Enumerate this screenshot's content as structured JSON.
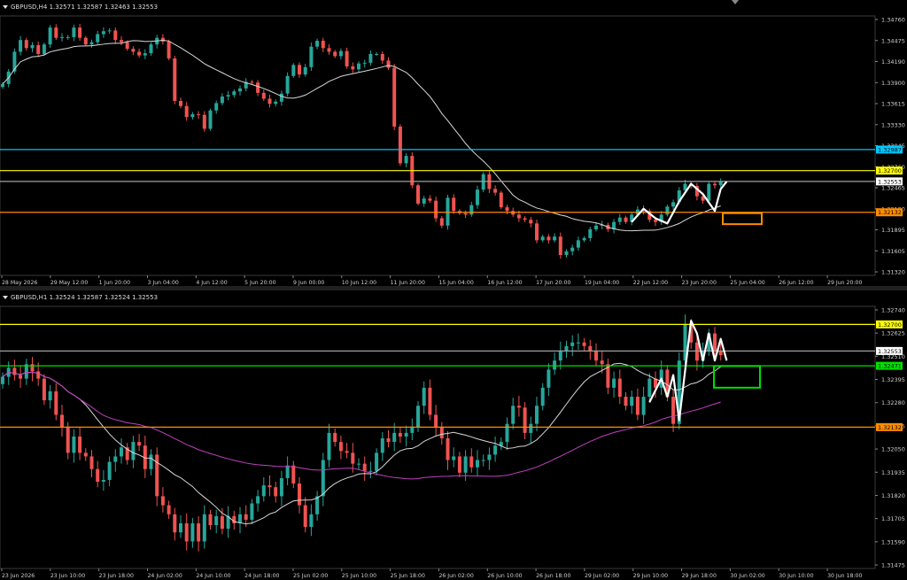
{
  "chart_data": [
    {
      "type": "candlestick",
      "symbol_label": "GBPUSD,H4  1.32571 1.32587 1.32463 1.32553",
      "ylim": [
        1.3132,
        1.3476
      ],
      "y_ticks": [
        "1.34760",
        "1.34475",
        "1.34190",
        "1.33900",
        "1.33615",
        "1.33330",
        "1.33045",
        "1.32760",
        "1.32465",
        "1.32180",
        "1.31895",
        "1.31605",
        "1.31320"
      ],
      "x_ticks": [
        "28 May 2026",
        "29 May 12:00",
        "1 Jun 20:00",
        "3 Jun 04:00",
        "4 Jun 12:00",
        "5 Jun 20:00",
        "9 Jun 00:00",
        "10 Jun 12:00",
        "11 Jun 20:00",
        "15 Jun 04:00",
        "16 Jun 12:00",
        "17 Jun 20:00",
        "19 Jun 04:00",
        "22 Jun 12:00",
        "23 Jun 20:00",
        "25 Jun 04:00",
        "26 Jun 12:00",
        "29 Jun 20:00"
      ],
      "closes": [
        1.3388,
        1.3405,
        1.3432,
        1.3448,
        1.3437,
        1.3441,
        1.3429,
        1.3442,
        1.3465,
        1.3451,
        1.3452,
        1.3452,
        1.3465,
        1.3451,
        1.3442,
        1.3445,
        1.3456,
        1.346,
        1.3461,
        1.3448,
        1.3445,
        1.3436,
        1.3432,
        1.3427,
        1.343,
        1.3442,
        1.3451,
        1.3446,
        1.3423,
        1.3365,
        1.3358,
        1.3343,
        1.3347,
        1.3346,
        1.3327,
        1.3352,
        1.3362,
        1.3371,
        1.3373,
        1.3378,
        1.3382,
        1.3391,
        1.339,
        1.3376,
        1.3368,
        1.3361,
        1.3364,
        1.3375,
        1.3399,
        1.3414,
        1.3401,
        1.3411,
        1.3439,
        1.3447,
        1.3437,
        1.3432,
        1.3426,
        1.3433,
        1.3412,
        1.3408,
        1.3416,
        1.3417,
        1.3429,
        1.3429,
        1.342,
        1.341,
        1.333,
        1.328,
        1.329,
        1.325,
        1.3225,
        1.3232,
        1.3229,
        1.3205,
        1.3195,
        1.3233,
        1.3215,
        1.3212,
        1.321,
        1.3223,
        1.3244,
        1.3265,
        1.3245,
        1.324,
        1.322,
        1.3215,
        1.321,
        1.3205,
        1.3203,
        1.3198,
        1.3175,
        1.318,
        1.3175,
        1.318,
        1.3155,
        1.316,
        1.3165,
        1.3175,
        1.3178,
        1.319,
        1.3195,
        1.3196,
        1.319,
        1.32,
        1.3206,
        1.32,
        1.321,
        1.3217,
        1.3215,
        1.3203,
        1.32,
        1.321,
        1.3221,
        1.3227,
        1.3243,
        1.3252,
        1.3249,
        1.3235,
        1.3229,
        1.3252,
        1.325,
        1.3255
      ],
      "lines": [
        {
          "name": "1.32987",
          "value": 1.32987,
          "color": "#00c8ff"
        },
        {
          "name": "1.32700",
          "value": 1.327,
          "color": "#ffff00"
        },
        {
          "name": "1.32553",
          "value": 1.32553,
          "color": "#a0a0a0"
        },
        {
          "name": "1.32132",
          "value": 1.32132,
          "color": "#ff8c00"
        }
      ]
    },
    {
      "type": "candlestick",
      "symbol_label": "GBPUSD,H1  1.32524 1.32587 1.32524 1.32553",
      "ylim": [
        1.3137,
        1.3278
      ],
      "y_ticks": [
        "1.32740",
        "1.32625",
        "1.32510",
        "1.32395",
        "1.32280",
        "1.32165",
        "1.32050",
        "1.31935",
        "1.31820",
        "1.31705",
        "1.31590",
        "1.31475"
      ],
      "x_ticks": [
        "23 Jun 2026",
        "23 Jun 10:00",
        "23 Jun 18:00",
        "24 Jun 02:00",
        "24 Jun 10:00",
        "24 Jun 18:00",
        "25 Jun 02:00",
        "25 Jun 10:00",
        "25 Jun 18:00",
        "26 Jun 02:00",
        "26 Jun 10:00",
        "26 Jun 18:00",
        "29 Jun 02:00",
        "29 Jun 10:00",
        "29 Jun 18:00",
        "30 Jun 02:00",
        "30 Jun 10:00",
        "30 Jun 18:00"
      ],
      "closes": [
        1.3241,
        1.3246,
        1.3242,
        1.324,
        1.3248,
        1.3244,
        1.324,
        1.3228,
        1.3233,
        1.322,
        1.3213,
        1.3199,
        1.3208,
        1.3199,
        1.3197,
        1.319,
        1.3183,
        1.3184,
        1.3194,
        1.3197,
        1.3202,
        1.3195,
        1.3205,
        1.3203,
        1.319,
        1.3198,
        1.3175,
        1.317,
        1.3165,
        1.3155,
        1.316,
        1.315,
        1.316,
        1.315,
        1.3165,
        1.3159,
        1.3164,
        1.3157,
        1.3164,
        1.316,
        1.3165,
        1.3162,
        1.3171,
        1.3175,
        1.3181,
        1.318,
        1.3175,
        1.3185,
        1.3192,
        1.3182,
        1.317,
        1.3158,
        1.3165,
        1.3175,
        1.3195,
        1.321,
        1.3205,
        1.32,
        1.3199,
        1.3193,
        1.3193,
        1.3189,
        1.3189,
        1.3199,
        1.3207,
        1.3205,
        1.321,
        1.3208,
        1.321,
        1.3213,
        1.3225,
        1.3235,
        1.322,
        1.3213,
        1.3207,
        1.3195,
        1.3197,
        1.3188,
        1.3197,
        1.3191,
        1.3195,
        1.3195,
        1.3198,
        1.3203,
        1.3205,
        1.3215,
        1.3225,
        1.3224,
        1.321,
        1.3215,
        1.3225,
        1.3235,
        1.3245,
        1.325,
        1.3255,
        1.3258,
        1.326,
        1.326,
        1.3258,
        1.3255,
        1.325,
        1.3248,
        1.3235,
        1.324,
        1.323,
        1.3225,
        1.323,
        1.322,
        1.323,
        1.324,
        1.3235,
        1.3245,
        1.323,
        1.3215,
        1.325,
        1.327,
        1.326,
        1.325,
        1.3255,
        1.3265,
        1.3255,
        1.3253
      ],
      "lines": [
        {
          "name": "1.32700",
          "value": 1.327,
          "color": "#ffff00"
        },
        {
          "name": "1.32553",
          "value": 1.32553,
          "color": "#a0a0a0"
        },
        {
          "name": "1.32471",
          "value": 1.32471,
          "color": "#00e000"
        },
        {
          "name": "1.32132",
          "value": 1.32132,
          "color": "#ff8c00"
        }
      ]
    }
  ]
}
